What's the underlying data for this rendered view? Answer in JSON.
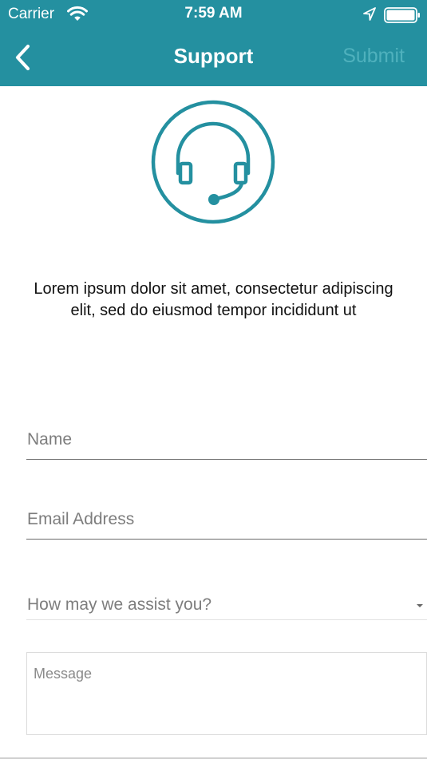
{
  "status_bar": {
    "carrier": "Carrier",
    "time": "7:59 AM",
    "icons": [
      "wifi-icon",
      "location-arrow-icon",
      "battery-icon"
    ]
  },
  "nav": {
    "back_icon": "chevron-left-icon",
    "title": "Support",
    "submit_label": "Submit"
  },
  "hero": {
    "icon": "headset-icon",
    "intro_text": "Lorem ipsum dolor sit amet, consectetur adipiscing elit, sed do eiusmod tempor incididunt ut"
  },
  "form": {
    "name": {
      "value": "",
      "placeholder": "Name"
    },
    "email": {
      "value": "",
      "placeholder": "Email Address"
    },
    "assist_select": {
      "selected": "How may we assist you?",
      "icon": "caret-down-icon"
    },
    "message": {
      "value": "",
      "placeholder": "Message"
    }
  },
  "colors": {
    "brand": "#2490a0",
    "submit_disabled": "#4fb1bd",
    "text": "#111111",
    "placeholder": "#7d7d7d"
  }
}
